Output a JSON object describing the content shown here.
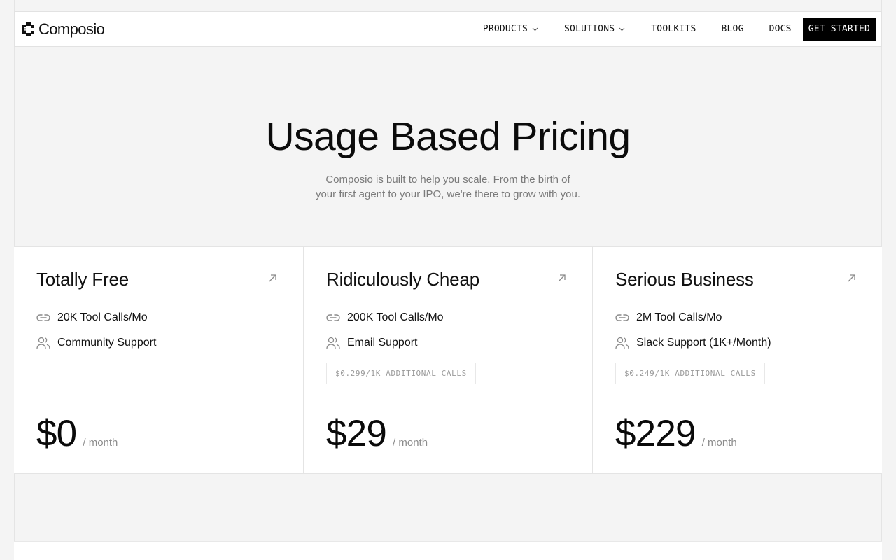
{
  "header": {
    "logo_text": "Composio",
    "nav": [
      {
        "label": "PRODUCTS",
        "has_dropdown": true
      },
      {
        "label": "SOLUTIONS",
        "has_dropdown": true
      },
      {
        "label": "TOOLKITS"
      },
      {
        "label": "BLOG"
      },
      {
        "label": "DOCS"
      }
    ],
    "cta_label": "GET STARTED"
  },
  "hero": {
    "title": "Usage Based Pricing",
    "subtitle_line1": "Composio is built to help you scale. From the birth of",
    "subtitle_line2": "your first agent to your IPO, we're there to grow with you."
  },
  "plans": [
    {
      "name": "Totally Free",
      "features": [
        {
          "icon": "link-icon",
          "text": "20K Tool Calls/Mo"
        },
        {
          "icon": "users-icon",
          "text": "Community Support"
        }
      ],
      "additional": "",
      "price": "$0",
      "period": "/ month"
    },
    {
      "name": "Ridiculously Cheap",
      "features": [
        {
          "icon": "link-icon",
          "text": "200K Tool Calls/Mo"
        },
        {
          "icon": "users-icon",
          "text": "Email Support"
        }
      ],
      "additional": "$0.299/1K ADDITIONAL CALLS",
      "price": "$29",
      "period": "/ month"
    },
    {
      "name": "Serious Business",
      "features": [
        {
          "icon": "link-icon",
          "text": "2M Tool Calls/Mo"
        },
        {
          "icon": "users-icon",
          "text": "Slack Support (1K+/Month)"
        }
      ],
      "additional": "$0.249/1K ADDITIONAL CALLS",
      "price": "$229",
      "period": "/ month"
    }
  ]
}
